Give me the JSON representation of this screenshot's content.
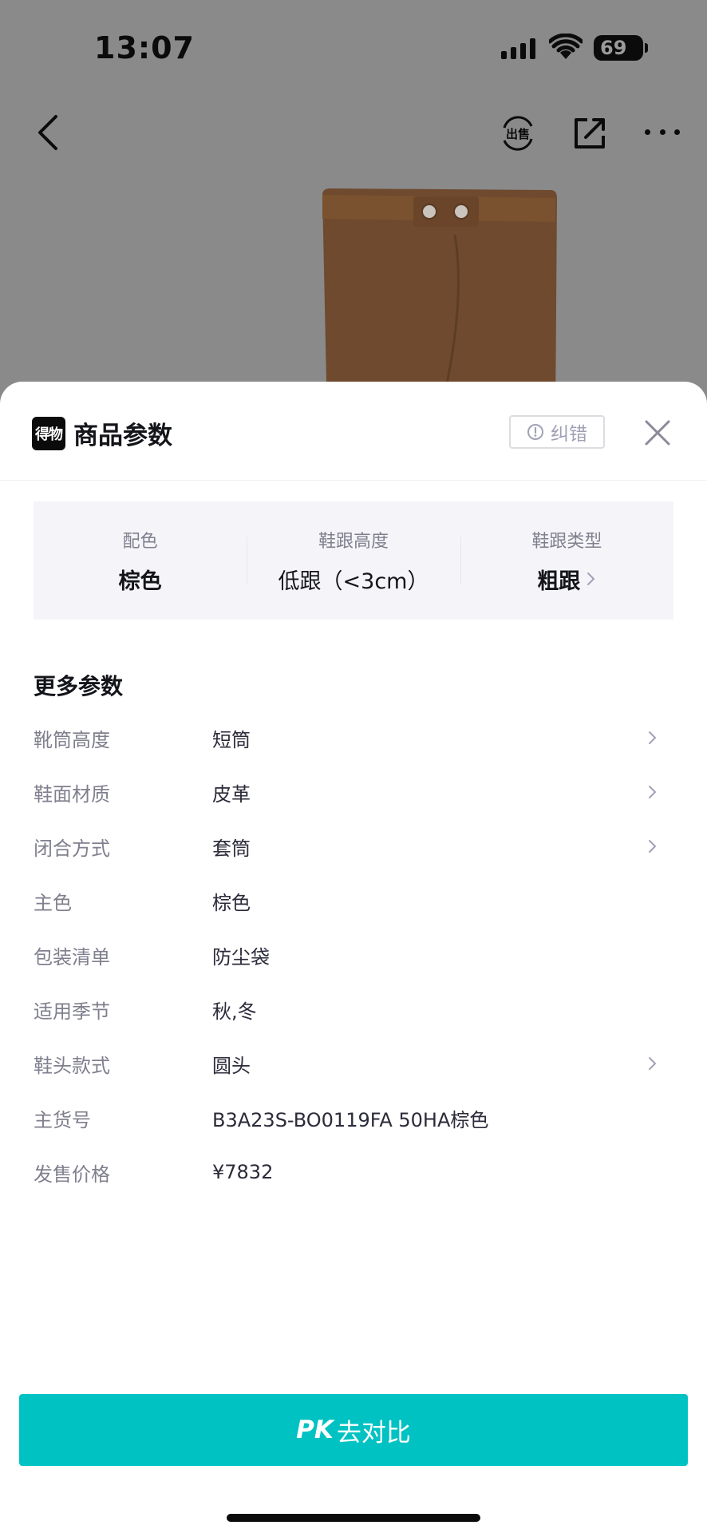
{
  "status_bar": {
    "time": "13:07",
    "battery": "69"
  },
  "nav": {
    "back_icon": "chevron-left-icon",
    "sell_icon": "sell-icon",
    "share_icon": "share-icon",
    "more_icon": "more-icon"
  },
  "sheet": {
    "logo_text": "得物",
    "title": "商品参数",
    "correct_label": "纠错",
    "close_icon": "close-icon"
  },
  "key_params": [
    {
      "label": "配色",
      "value": "棕色"
    },
    {
      "label": "鞋跟高度",
      "value": "低跟（<3cm）"
    },
    {
      "label": "鞋跟类型",
      "value": "粗跟"
    }
  ],
  "more_params": {
    "title": "更多参数",
    "rows": [
      {
        "label": "靴筒高度",
        "value": "短筒",
        "has_arrow": true
      },
      {
        "label": "鞋面材质",
        "value": "皮革",
        "has_arrow": true
      },
      {
        "label": "闭合方式",
        "value": "套筒",
        "has_arrow": true
      },
      {
        "label": "主色",
        "value": "棕色",
        "has_arrow": false
      },
      {
        "label": "包装清单",
        "value": "防尘袋",
        "has_arrow": false
      },
      {
        "label": "适用季节",
        "value": "秋,冬",
        "has_arrow": false
      },
      {
        "label": "鞋头款式",
        "value": "圆头",
        "has_arrow": true
      },
      {
        "label": "主货号",
        "value": "B3A23S-BO0119FA 50HA棕色",
        "has_arrow": false
      },
      {
        "label": "发售价格",
        "value": "¥7832",
        "has_arrow": false
      }
    ]
  },
  "pk_button": {
    "prefix": "PK",
    "label": "去对比"
  },
  "colors": {
    "accent": "#01c2c3",
    "text_primary": "#14151a",
    "text_secondary": "#7f7f8e",
    "card_bg": "#f5f5f9"
  }
}
